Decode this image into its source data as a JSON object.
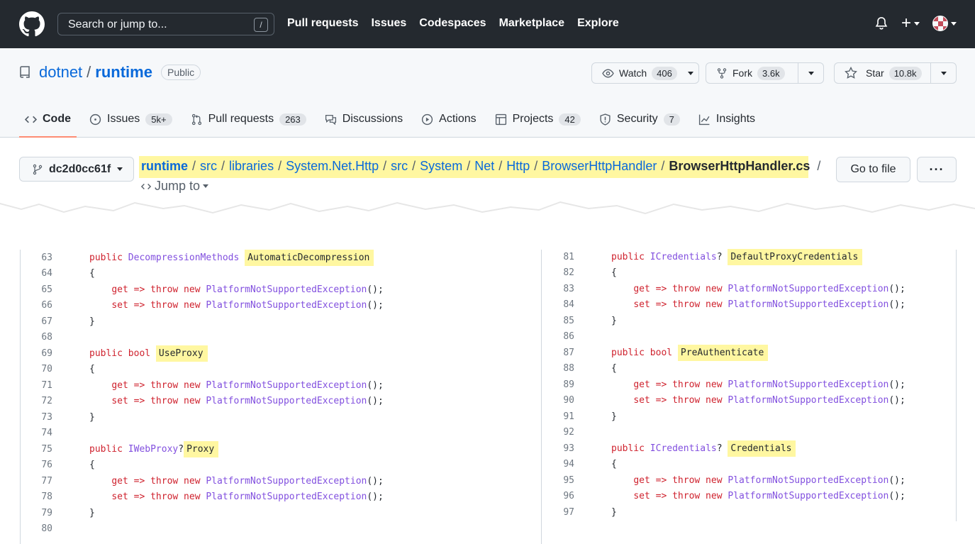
{
  "header": {
    "search_placeholder": "Search or jump to...",
    "search_key": "/",
    "nav": [
      "Pull requests",
      "Issues",
      "Codespaces",
      "Marketplace",
      "Explore"
    ],
    "plus_label": "+"
  },
  "repo": {
    "owner": "dotnet",
    "separator": "/",
    "name": "runtime",
    "visibility": "Public",
    "watch": {
      "label": "Watch",
      "count": "406"
    },
    "fork": {
      "label": "Fork",
      "count": "3.6k"
    },
    "star": {
      "label": "Star",
      "count": "10.8k"
    }
  },
  "tabs": [
    {
      "label": "Code",
      "count": ""
    },
    {
      "label": "Issues",
      "count": "5k+"
    },
    {
      "label": "Pull requests",
      "count": "263"
    },
    {
      "label": "Discussions",
      "count": ""
    },
    {
      "label": "Actions",
      "count": ""
    },
    {
      "label": "Projects",
      "count": "42"
    },
    {
      "label": "Security",
      "count": "7"
    },
    {
      "label": "Insights",
      "count": ""
    }
  ],
  "file": {
    "branch": "dc2d0cc61f",
    "path": [
      "runtime",
      "src",
      "libraries",
      "System.Net.Http",
      "src",
      "System",
      "Net",
      "Http",
      "BrowserHttpHandler"
    ],
    "filename": "BrowserHttpHandler.cs",
    "path_separator": "/",
    "jump_to": "Jump to",
    "go_to_file": "Go to file",
    "more": "···"
  },
  "code": {
    "left": [
      {
        "n": "63",
        "parts": [
          [
            "k",
            "public "
          ],
          [
            "t",
            "DecompressionMethods "
          ],
          [
            "hl",
            "AutomaticDecompression"
          ]
        ]
      },
      {
        "n": "64",
        "parts": [
          [
            "p",
            "{"
          ]
        ]
      },
      {
        "n": "65",
        "parts": [
          [
            "p",
            "    "
          ],
          [
            "k",
            "get => throw new "
          ],
          [
            "t",
            "PlatformNotSupportedException"
          ],
          [
            "p",
            "();"
          ]
        ]
      },
      {
        "n": "66",
        "parts": [
          [
            "p",
            "    "
          ],
          [
            "k",
            "set => throw new "
          ],
          [
            "t",
            "PlatformNotSupportedException"
          ],
          [
            "p",
            "();"
          ]
        ]
      },
      {
        "n": "67",
        "parts": [
          [
            "p",
            "}"
          ]
        ]
      },
      {
        "n": "68",
        "parts": []
      },
      {
        "n": "69",
        "parts": [
          [
            "k",
            "public bool "
          ],
          [
            "hl",
            "UseProxy"
          ]
        ]
      },
      {
        "n": "70",
        "parts": [
          [
            "p",
            "{"
          ]
        ]
      },
      {
        "n": "71",
        "parts": [
          [
            "p",
            "    "
          ],
          [
            "k",
            "get => throw new "
          ],
          [
            "t",
            "PlatformNotSupportedException"
          ],
          [
            "p",
            "();"
          ]
        ]
      },
      {
        "n": "72",
        "parts": [
          [
            "p",
            "    "
          ],
          [
            "k",
            "set => throw new "
          ],
          [
            "t",
            "PlatformNotSupportedException"
          ],
          [
            "p",
            "();"
          ]
        ]
      },
      {
        "n": "73",
        "parts": [
          [
            "p",
            "}"
          ]
        ]
      },
      {
        "n": "74",
        "parts": []
      },
      {
        "n": "75",
        "parts": [
          [
            "k",
            "public "
          ],
          [
            "t",
            "IWebProxy"
          ],
          [
            "p",
            "?"
          ],
          [
            "hl",
            "Proxy"
          ]
        ]
      },
      {
        "n": "76",
        "parts": [
          [
            "p",
            "{"
          ]
        ]
      },
      {
        "n": "77",
        "parts": [
          [
            "p",
            "    "
          ],
          [
            "k",
            "get => throw new "
          ],
          [
            "t",
            "PlatformNotSupportedException"
          ],
          [
            "p",
            "();"
          ]
        ]
      },
      {
        "n": "78",
        "parts": [
          [
            "p",
            "    "
          ],
          [
            "k",
            "set => throw new "
          ],
          [
            "t",
            "PlatformNotSupportedException"
          ],
          [
            "p",
            "();"
          ]
        ]
      },
      {
        "n": "79",
        "parts": [
          [
            "p",
            "}"
          ]
        ]
      },
      {
        "n": "80",
        "parts": []
      }
    ],
    "right": [
      {
        "n": "81",
        "parts": [
          [
            "k",
            "public "
          ],
          [
            "t",
            "ICredentials"
          ],
          [
            "p",
            "? "
          ],
          [
            "hl",
            "DefaultProxyCredentials"
          ]
        ]
      },
      {
        "n": "82",
        "parts": [
          [
            "p",
            "{"
          ]
        ]
      },
      {
        "n": "83",
        "parts": [
          [
            "p",
            "    "
          ],
          [
            "k",
            "get => throw new "
          ],
          [
            "t",
            "PlatformNotSupportedException"
          ],
          [
            "p",
            "();"
          ]
        ]
      },
      {
        "n": "84",
        "parts": [
          [
            "p",
            "    "
          ],
          [
            "k",
            "set => throw new "
          ],
          [
            "t",
            "PlatformNotSupportedException"
          ],
          [
            "p",
            "();"
          ]
        ]
      },
      {
        "n": "85",
        "parts": [
          [
            "p",
            "}"
          ]
        ]
      },
      {
        "n": "86",
        "parts": []
      },
      {
        "n": "87",
        "parts": [
          [
            "k",
            "public bool "
          ],
          [
            "hl",
            "PreAuthenticate"
          ]
        ]
      },
      {
        "n": "88",
        "parts": [
          [
            "p",
            "{"
          ]
        ]
      },
      {
        "n": "89",
        "parts": [
          [
            "p",
            "    "
          ],
          [
            "k",
            "get => throw new "
          ],
          [
            "t",
            "PlatformNotSupportedException"
          ],
          [
            "p",
            "();"
          ]
        ]
      },
      {
        "n": "90",
        "parts": [
          [
            "p",
            "    "
          ],
          [
            "k",
            "set => throw new "
          ],
          [
            "t",
            "PlatformNotSupportedException"
          ],
          [
            "p",
            "();"
          ]
        ]
      },
      {
        "n": "91",
        "parts": [
          [
            "p",
            "}"
          ]
        ]
      },
      {
        "n": "92",
        "parts": []
      },
      {
        "n": "93",
        "parts": [
          [
            "k",
            "public "
          ],
          [
            "t",
            "ICredentials"
          ],
          [
            "p",
            "? "
          ],
          [
            "hl",
            "Credentials"
          ]
        ]
      },
      {
        "n": "94",
        "parts": [
          [
            "p",
            "{"
          ]
        ]
      },
      {
        "n": "95",
        "parts": [
          [
            "p",
            "    "
          ],
          [
            "k",
            "get => throw new "
          ],
          [
            "t",
            "PlatformNotSupportedException"
          ],
          [
            "p",
            "();"
          ]
        ]
      },
      {
        "n": "96",
        "parts": [
          [
            "p",
            "    "
          ],
          [
            "k",
            "set => throw new "
          ],
          [
            "t",
            "PlatformNotSupportedException"
          ],
          [
            "p",
            "();"
          ]
        ]
      },
      {
        "n": "97",
        "parts": [
          [
            "p",
            "}"
          ]
        ]
      }
    ]
  },
  "colors": {
    "header_bg": "#24292f",
    "highlight": "#fff7a1",
    "link": "#0969da",
    "keyword": "#cf222e",
    "type": "#8250df",
    "tab_underline": "#fd8c73"
  }
}
